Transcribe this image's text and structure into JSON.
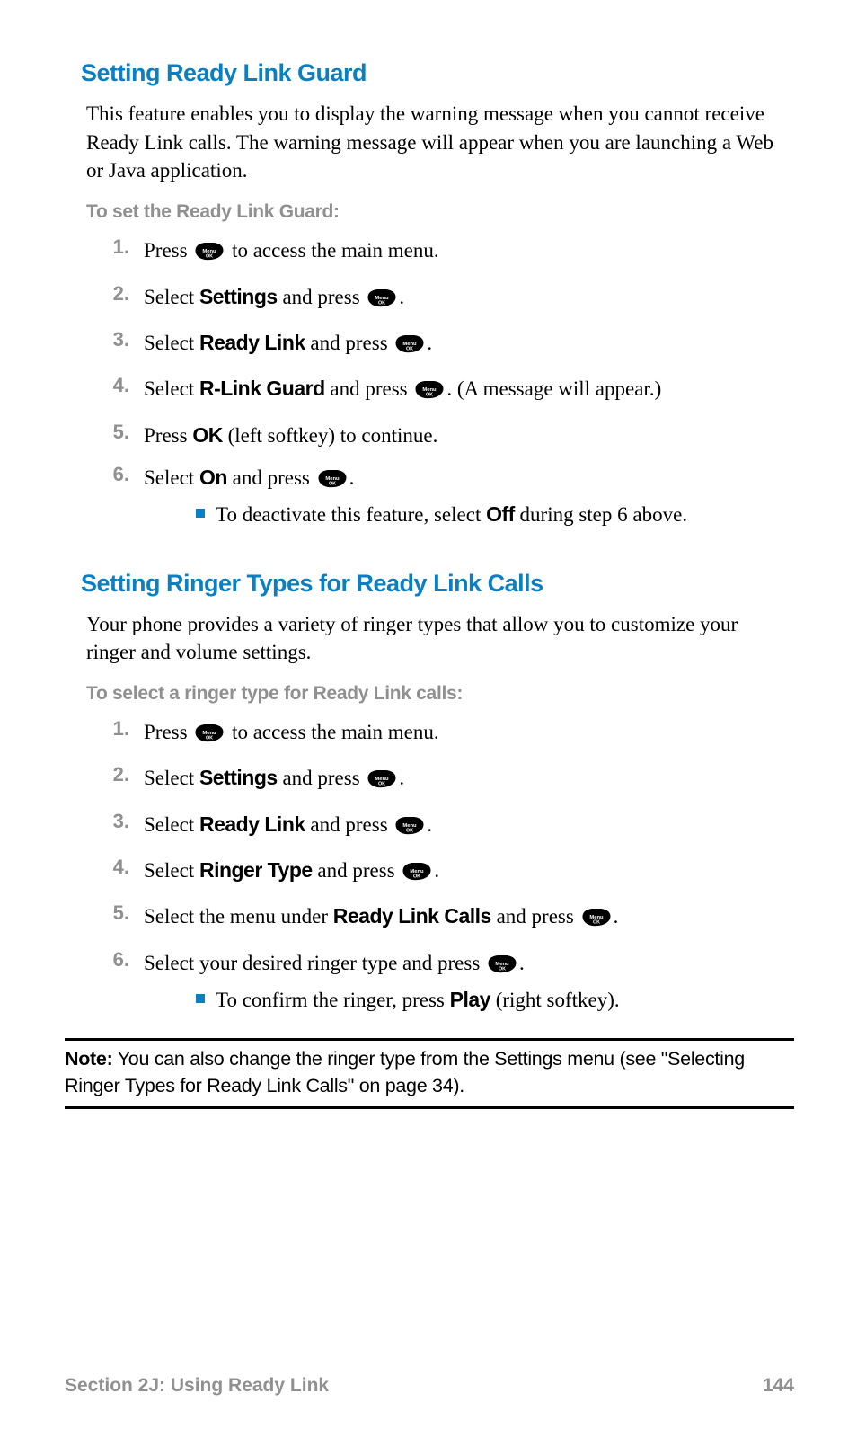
{
  "sec1": {
    "heading": "Setting Ready Link Guard",
    "intro": "This feature enables you to display the warning message when you cannot receive Ready Link calls. The warning message will appear when you are launching a Web or Java application.",
    "subhead": "To set the Ready Link Guard:",
    "steps": {
      "n1": "1.",
      "s1a": "Press ",
      "s1b": " to access the main menu.",
      "n2": "2.",
      "s2a": "Select ",
      "s2b": "Settings",
      "s2c": " and press ",
      "s2d": ".",
      "n3": "3.",
      "s3a": "Select ",
      "s3b": "Ready Link",
      "s3c": " and press ",
      "s3d": ".",
      "n4": "4.",
      "s4a": "Select ",
      "s4b": "R-Link Guard",
      "s4c": " and press ",
      "s4d": ". (A message will appear.)",
      "n5": "5.",
      "s5a": "Press ",
      "s5b": "OK",
      "s5c": " (left softkey) to continue.",
      "n6": "6.",
      "s6a": "Select ",
      "s6b": "On",
      "s6c": " and press ",
      "s6d": ".",
      "sub1a": "To deactivate this feature, select ",
      "sub1b": "Off",
      "sub1c": " during step 6 above."
    }
  },
  "sec2": {
    "heading": "Setting Ringer Types for Ready Link Calls",
    "intro": "Your phone provides a variety of ringer types that allow you to customize your ringer and volume settings.",
    "subhead": "To select a ringer type for Ready Link calls:",
    "steps": {
      "n1": "1.",
      "s1a": "Press ",
      "s1b": " to access the main menu.",
      "n2": "2.",
      "s2a": "Select ",
      "s2b": "Settings",
      "s2c": " and press ",
      "s2d": ".",
      "n3": "3.",
      "s3a": "Select ",
      "s3b": "Ready Link",
      "s3c": " and press ",
      "s3d": ".",
      "n4": "4.",
      "s4a": "Select ",
      "s4b": "Ringer Type",
      "s4c": " and press ",
      "s4d": ".",
      "n5": "5.",
      "s5a": "Select the menu under ",
      "s5b": "Ready Link Calls",
      "s5c": " and press ",
      "s5d": ".",
      "n6": "6.",
      "s6a": "Select your desired ringer type and press ",
      "s6b": ".",
      "sub1a": "To confirm the ringer, press ",
      "sub1b": "Play",
      "sub1c": " (right softkey)."
    }
  },
  "note": {
    "label": "Note:",
    "text": " You can also change the ringer type from the Settings menu (see \"Selecting Ringer Types for Ready Link Calls\" on page 34)."
  },
  "footer": {
    "left": "Section 2J: Using Ready Link",
    "right": "144"
  }
}
